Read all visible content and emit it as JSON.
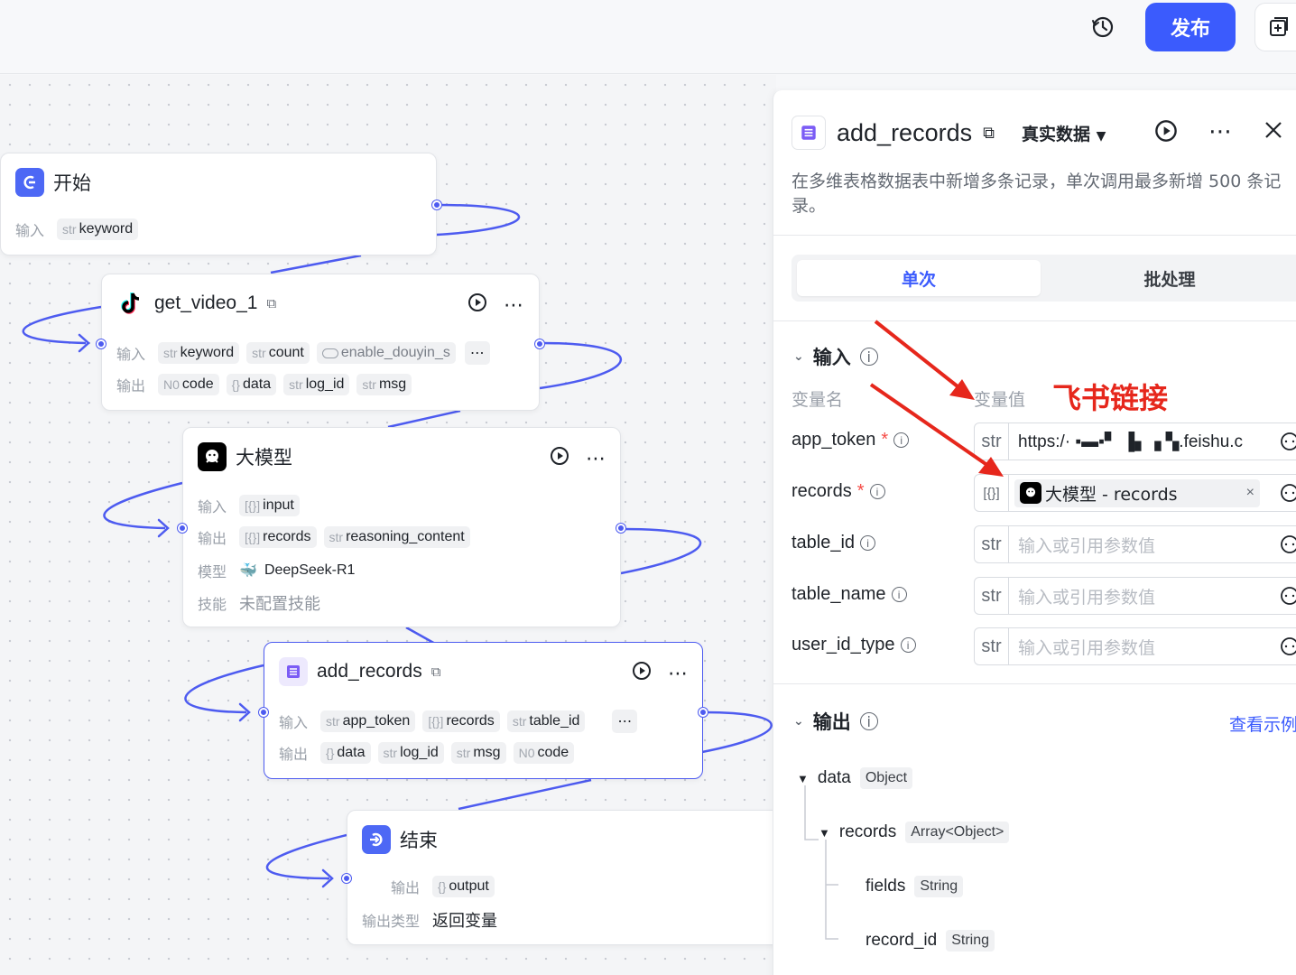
{
  "header": {
    "publish_label": "发布"
  },
  "nodes": {
    "start": {
      "title": "开始",
      "input_label": "输入",
      "inputs": [
        {
          "type": "str",
          "name": "keyword"
        }
      ]
    },
    "get_video": {
      "title": "get_video_1",
      "input_label": "输入",
      "output_label": "输出",
      "inputs": [
        {
          "type": "str",
          "name": "keyword"
        },
        {
          "type": "str",
          "name": "count"
        },
        {
          "type": "toggle",
          "name": "enable_douyin_s"
        }
      ],
      "outputs": [
        {
          "type": "N0",
          "name": "code"
        },
        {
          "type": "{}",
          "name": "data"
        },
        {
          "type": "str",
          "name": "log_id"
        },
        {
          "type": "str",
          "name": "msg"
        }
      ]
    },
    "llm": {
      "title": "大模型",
      "input_label": "输入",
      "output_label": "输出",
      "model_label": "模型",
      "skill_label": "技能",
      "inputs": [
        {
          "type": "[{}]",
          "name": "input"
        }
      ],
      "outputs": [
        {
          "type": "[{}]",
          "name": "records"
        },
        {
          "type": "str",
          "name": "reasoning_content"
        }
      ],
      "model": "DeepSeek-R1",
      "skill": "未配置技能"
    },
    "add_records": {
      "title": "add_records",
      "input_label": "输入",
      "output_label": "输出",
      "inputs": [
        {
          "type": "str",
          "name": "app_token"
        },
        {
          "type": "[{}]",
          "name": "records"
        },
        {
          "type": "str",
          "name": "table_id"
        }
      ],
      "outputs": [
        {
          "type": "{}",
          "name": "data"
        },
        {
          "type": "str",
          "name": "log_id"
        },
        {
          "type": "str",
          "name": "msg"
        },
        {
          "type": "N0",
          "name": "code"
        }
      ]
    },
    "end": {
      "title": "结束",
      "output_label": "输出",
      "output_type_label": "输出类型",
      "outputs": [
        {
          "type": "{}",
          "name": "output"
        }
      ],
      "output_type": "返回变量"
    }
  },
  "panel": {
    "title": "add_records",
    "mode": "真实数据",
    "description": "在多维表格数据表中新增多条记录，单次调用最多新增 500 条记录。",
    "tabs": [
      "单次",
      "批处理"
    ],
    "input_section": "输入",
    "col_name": "变量名",
    "col_value": "变量值",
    "params": [
      {
        "name": "app_token",
        "required": true,
        "type": "str",
        "value": "https:/· ▪▬▪▘ ▐▖▗ ▚.feishu.c"
      },
      {
        "name": "records",
        "required": true,
        "type": "[{}]",
        "value": "大模型 - records"
      },
      {
        "name": "table_id",
        "required": false,
        "type": "str",
        "value": "",
        "placeholder": "输入或引用参数值"
      },
      {
        "name": "table_name",
        "required": false,
        "type": "str",
        "value": "",
        "placeholder": "输入或引用参数值"
      },
      {
        "name": "user_id_type",
        "required": false,
        "type": "str",
        "value": "",
        "placeholder": "输入或引用参数值"
      }
    ],
    "output_section": "输出",
    "view_example": "查看示例",
    "outputs": [
      {
        "name": "data",
        "type": "Object"
      },
      {
        "name": "records",
        "type": "Array<Object>"
      },
      {
        "name": "fields",
        "type": "String"
      },
      {
        "name": "record_id",
        "type": "String"
      }
    ]
  },
  "annotation": "飞书链接",
  "colors": {
    "accent": "#4d5bf0",
    "publish": "#3b5bfd",
    "annotation": "#e6271c"
  }
}
